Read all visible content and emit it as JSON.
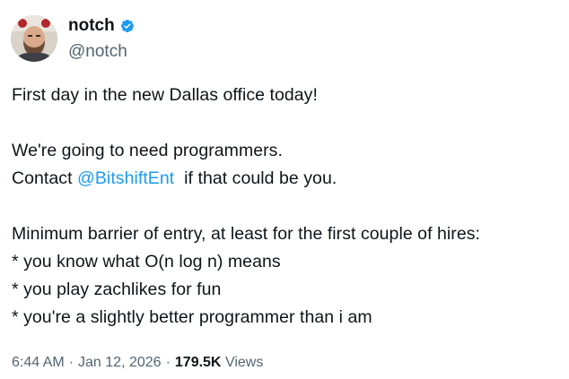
{
  "author": {
    "display_name": "notch",
    "handle": "@notch",
    "verified": true,
    "avatar_icon": "avatar-photo",
    "verified_badge_color": "#1d9bf0"
  },
  "tweet": {
    "line_1": "First day in the new Dallas office today!",
    "line_2": "We're going to need programmers.",
    "line_3_prefix": "Contact ",
    "line_3_mention": "@BitshiftEnt",
    "line_3_suffix": "  if that could be you.",
    "line_4": "Minimum barrier of entry, at least for the first couple of hires:",
    "line_5": "* you know what O(n log n) means",
    "line_6": "* you play zachlikes for fun",
    "line_7": "* you're a slightly better programmer than i am"
  },
  "meta": {
    "time": "6:44 AM",
    "separator": "·",
    "date": "Jan 12, 2026",
    "views_count": "179.5K",
    "views_label": "Views"
  },
  "colors": {
    "text": "#0f1419",
    "secondary": "#536471",
    "link": "#1d9bf0"
  }
}
